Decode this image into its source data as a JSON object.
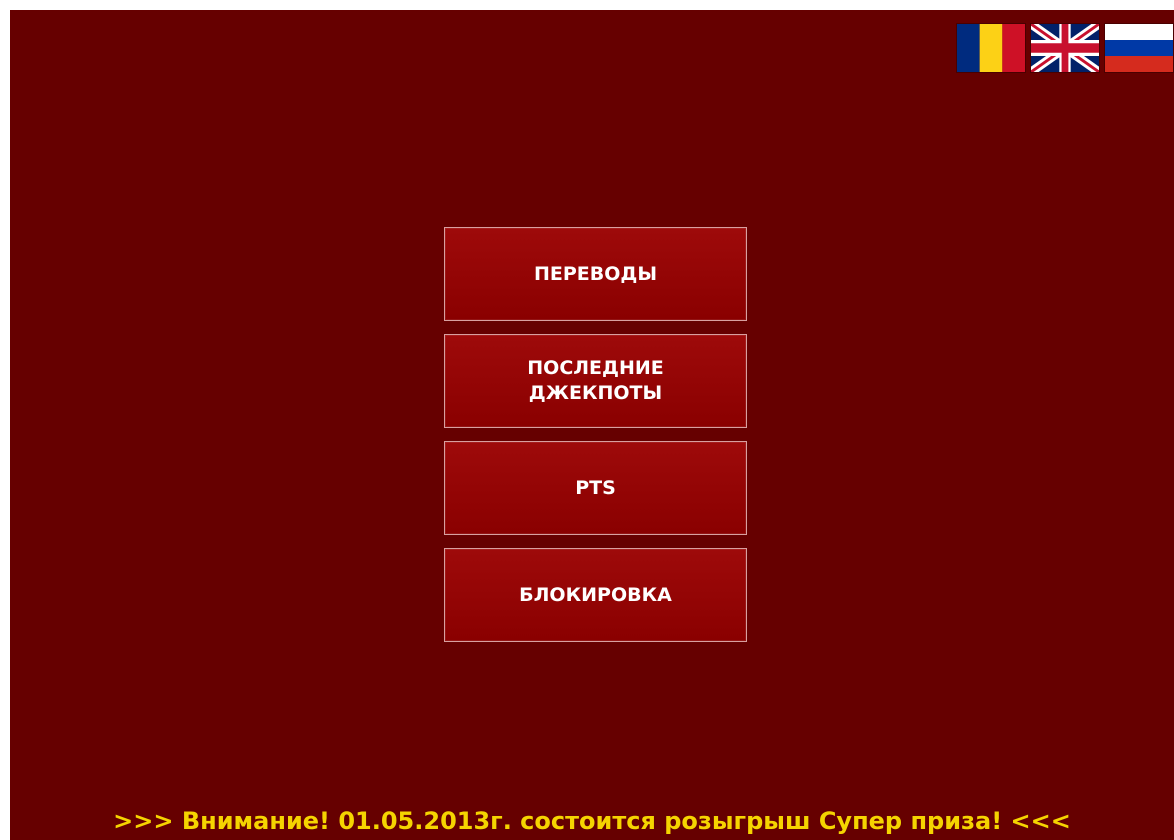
{
  "languages": [
    {
      "code": "ro",
      "icon": "romania-flag-icon"
    },
    {
      "code": "en",
      "icon": "uk-flag-icon"
    },
    {
      "code": "ru",
      "icon": "russia-flag-icon"
    }
  ],
  "menu": {
    "transfers_label": "ПЕРЕВОДЫ",
    "last_jackpots_label": "ПОСЛЕДНИЕ ДЖЕКПОТЫ",
    "pts_label": "PTS",
    "blocking_label": "БЛОКИРОВКА"
  },
  "ticker": {
    "text": ">>> Внимание! 01.05.2013г. состоится розыгрыш Супер приза! <<<"
  },
  "colors": {
    "background": "#660000",
    "button": "#9a0000",
    "button_border": "#d8a0a0",
    "ticker_text": "#f5d400"
  }
}
